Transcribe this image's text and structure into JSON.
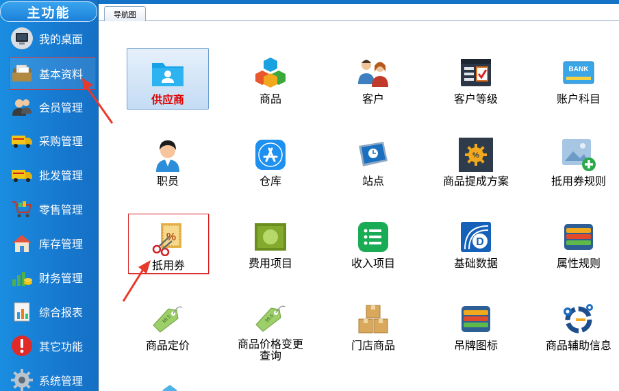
{
  "sidebar": {
    "title": "主功能",
    "items": [
      {
        "label": "我的桌面",
        "icon": "monitor-icon"
      },
      {
        "label": "基本资料",
        "icon": "folder-documents-icon",
        "selected": true
      },
      {
        "label": "会员管理",
        "icon": "users-icon"
      },
      {
        "label": "采购管理",
        "icon": "truck-icon"
      },
      {
        "label": "批发管理",
        "icon": "delivery-truck-icon"
      },
      {
        "label": "零售管理",
        "icon": "shopping-cart-icon"
      },
      {
        "label": "库存管理",
        "icon": "house-icon"
      },
      {
        "label": "财务管理",
        "icon": "money-chart-icon"
      },
      {
        "label": "综合报表",
        "icon": "report-chart-icon"
      },
      {
        "label": "其它功能",
        "icon": "exclamation-icon"
      },
      {
        "label": "系统管理",
        "icon": "gear-icon"
      }
    ]
  },
  "tabs": [
    {
      "label": "导航图"
    }
  ],
  "grid": [
    {
      "label": "供应商",
      "icon": "folder-user-icon",
      "active": true
    },
    {
      "label": "商品",
      "icon": "cubes-icon"
    },
    {
      "label": "客户",
      "icon": "people-icon"
    },
    {
      "label": "客户等级",
      "icon": "checklist-window-icon"
    },
    {
      "label": "账户科目",
      "icon": "bank-card-icon",
      "icon_text": "BANK"
    },
    {
      "label": "职员",
      "icon": "employee-icon"
    },
    {
      "label": "仓库",
      "icon": "app-store-icon"
    },
    {
      "label": "站点",
      "icon": "clock-screen-icon"
    },
    {
      "label": "商品提成方案",
      "icon": "commission-icon"
    },
    {
      "label": "抵用券规则",
      "icon": "image-add-icon"
    },
    {
      "label": "抵用券",
      "icon": "coupon-scissors-icon",
      "boxed": true,
      "icon_text": "%"
    },
    {
      "label": "费用项目",
      "icon": "green-square-icon"
    },
    {
      "label": "收入项目",
      "icon": "green-list-icon"
    },
    {
      "label": "基础数据",
      "icon": "data-d-icon",
      "icon_text": "D"
    },
    {
      "label": "属性规则",
      "icon": "layers-icon"
    },
    {
      "label": "商品定价",
      "icon": "price-tag-icon"
    },
    {
      "label": "商品价格变更查询",
      "icon": "price-tag-change-icon"
    },
    {
      "label": "门店商品",
      "icon": "boxes-icon"
    },
    {
      "label": "吊牌图标",
      "icon": "hangtag-layers-icon"
    },
    {
      "label": "商品辅助信息",
      "icon": "gears-info-icon"
    }
  ],
  "colors": {
    "sidebar": "#1779d0",
    "highlight": "#e03030",
    "active_label": "#e00000"
  }
}
